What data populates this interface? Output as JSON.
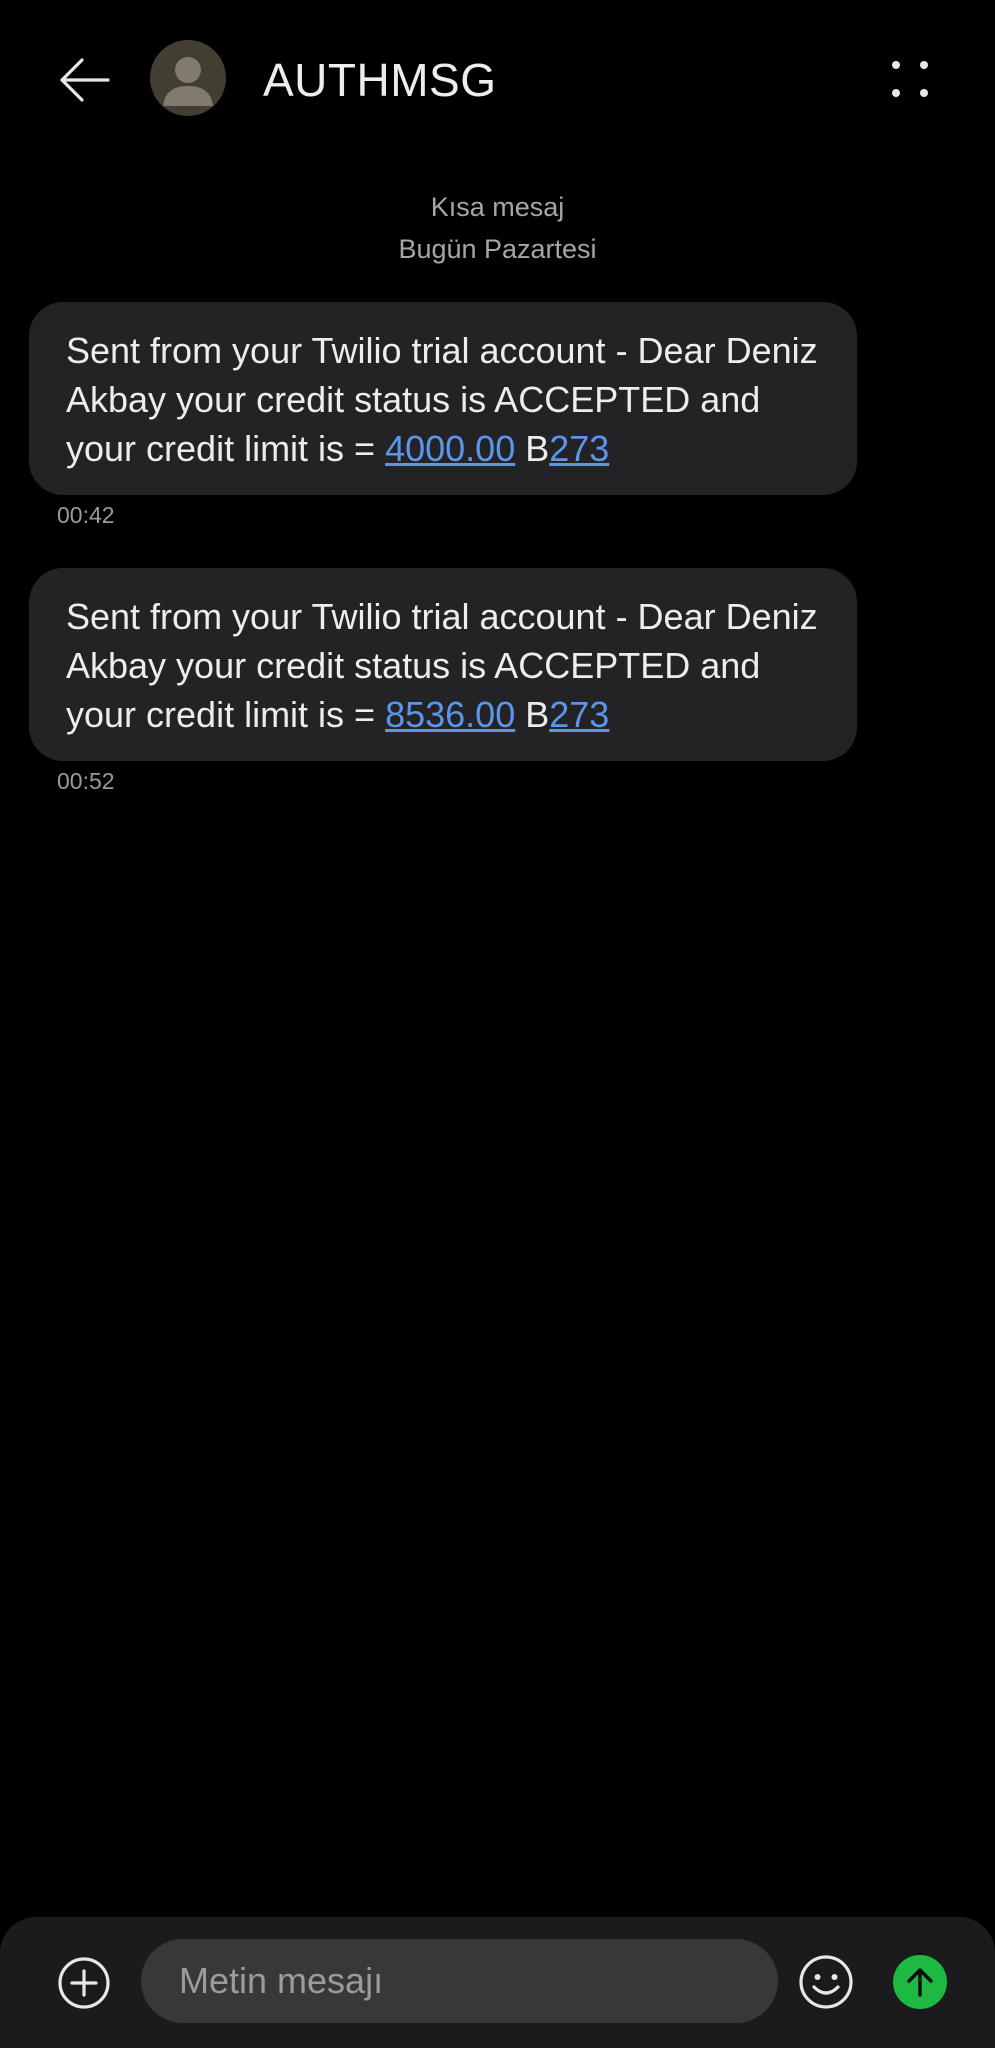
{
  "header": {
    "contact_name": "AUTHMSG",
    "icons": {
      "back": "arrow-left-icon",
      "avatar": "person-icon",
      "more": "more-dots-icon"
    }
  },
  "thread": {
    "type_label": "Kısa mesaj",
    "date_label": "Bugün Pazartesi"
  },
  "messages": [
    {
      "text_before": "Sent from your Twilio trial account - Dear Deniz Akbay your credit status is ACCEPTED and your credit limit is = ",
      "amount_link": "4000.00",
      "mid_text": " B",
      "code_link": "273",
      "time": "00:42"
    },
    {
      "text_before": "Sent from your Twilio trial account - Dear Deniz Akbay your credit status is ACCEPTED and your credit limit is = ",
      "amount_link": "8536.00",
      "mid_text": " B",
      "code_link": "273",
      "time": "00:52"
    }
  ],
  "composer": {
    "placeholder": "Metin mesajı",
    "icons": {
      "attach": "plus-circle-icon",
      "emoji": "smiley-icon",
      "send": "send-arrow-icon"
    }
  },
  "colors": {
    "background": "#000000",
    "bubble": "#232325",
    "link": "#5b96ea",
    "send_button": "#1db942",
    "composer": "#1b1b1d"
  }
}
